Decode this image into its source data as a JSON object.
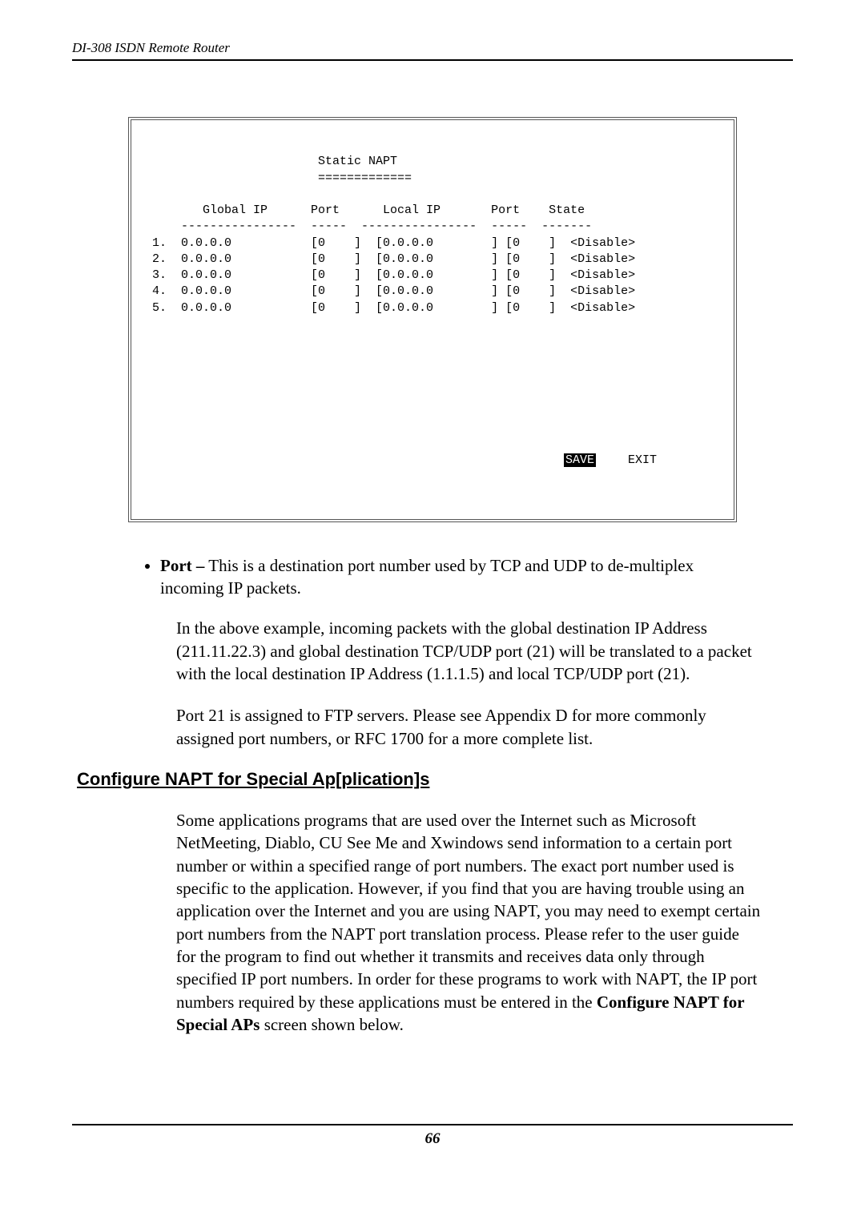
{
  "header": "DI-308 ISDN Remote Router",
  "terminal": {
    "title": "                       Static NAPT",
    "underline": "                       =============",
    "colHeader": "       Global IP      Port      Local IP       Port    State",
    "colDashes": "    ----------------  -----  ----------------  -----  -------",
    "rows": [
      "1.  0.0.0.0           [0    ]  [0.0.0.0        ] [0    ]  <Disable>",
      "2.  0.0.0.0           [0    ]  [0.0.0.0        ] [0    ]  <Disable>",
      "3.  0.0.0.0           [0    ]  [0.0.0.0        ] [0    ]  <Disable>",
      "4.  0.0.0.0           [0    ]  [0.0.0.0        ] [0    ]  <Disable>",
      "5.  0.0.0.0           [0    ]  [0.0.0.0        ] [0    ]  <Disable>"
    ],
    "save": "SAVE",
    "exit": "EXIT"
  },
  "bullet": {
    "label": "Port –",
    "text": " This is a destination port number used by TCP and UDP to de-multiplex incoming IP packets."
  },
  "para1": "In the above example, incoming packets with the global destination IP Address (211.11.22.3) and global destination TCP/UDP port (21) will be translated to a packet with the local destination IP Address (1.1.1.5) and local TCP/UDP port (21).",
  "para2": "Port 21 is assigned to FTP servers. Please see Appendix D for more commonly assigned port numbers, or RFC 1700 for a more complete list.",
  "sectionHeading": " Configure NAPT for Special Ap[plication]s",
  "para3_a": "Some applications programs that are used over the Internet such as Microsoft NetMeeting, Diablo, CU See Me and Xwindows send information to a certain port number or within a specified range of port numbers. The exact port number used is specific to the application. However, if you find that you are having trouble using an application over the Internet and you are using NAPT, you may need to exempt certain port numbers from the NAPT port translation process. Please refer to the user guide for the program to find out whether it transmits and receives data only through specified IP port numbers. In order for these programs to work with NAPT, the IP port numbers required by these applications must be entered in the ",
  "para3_bold": "Configure NAPT for Special APs",
  "para3_b": " screen shown below.",
  "pageNumber": "66"
}
